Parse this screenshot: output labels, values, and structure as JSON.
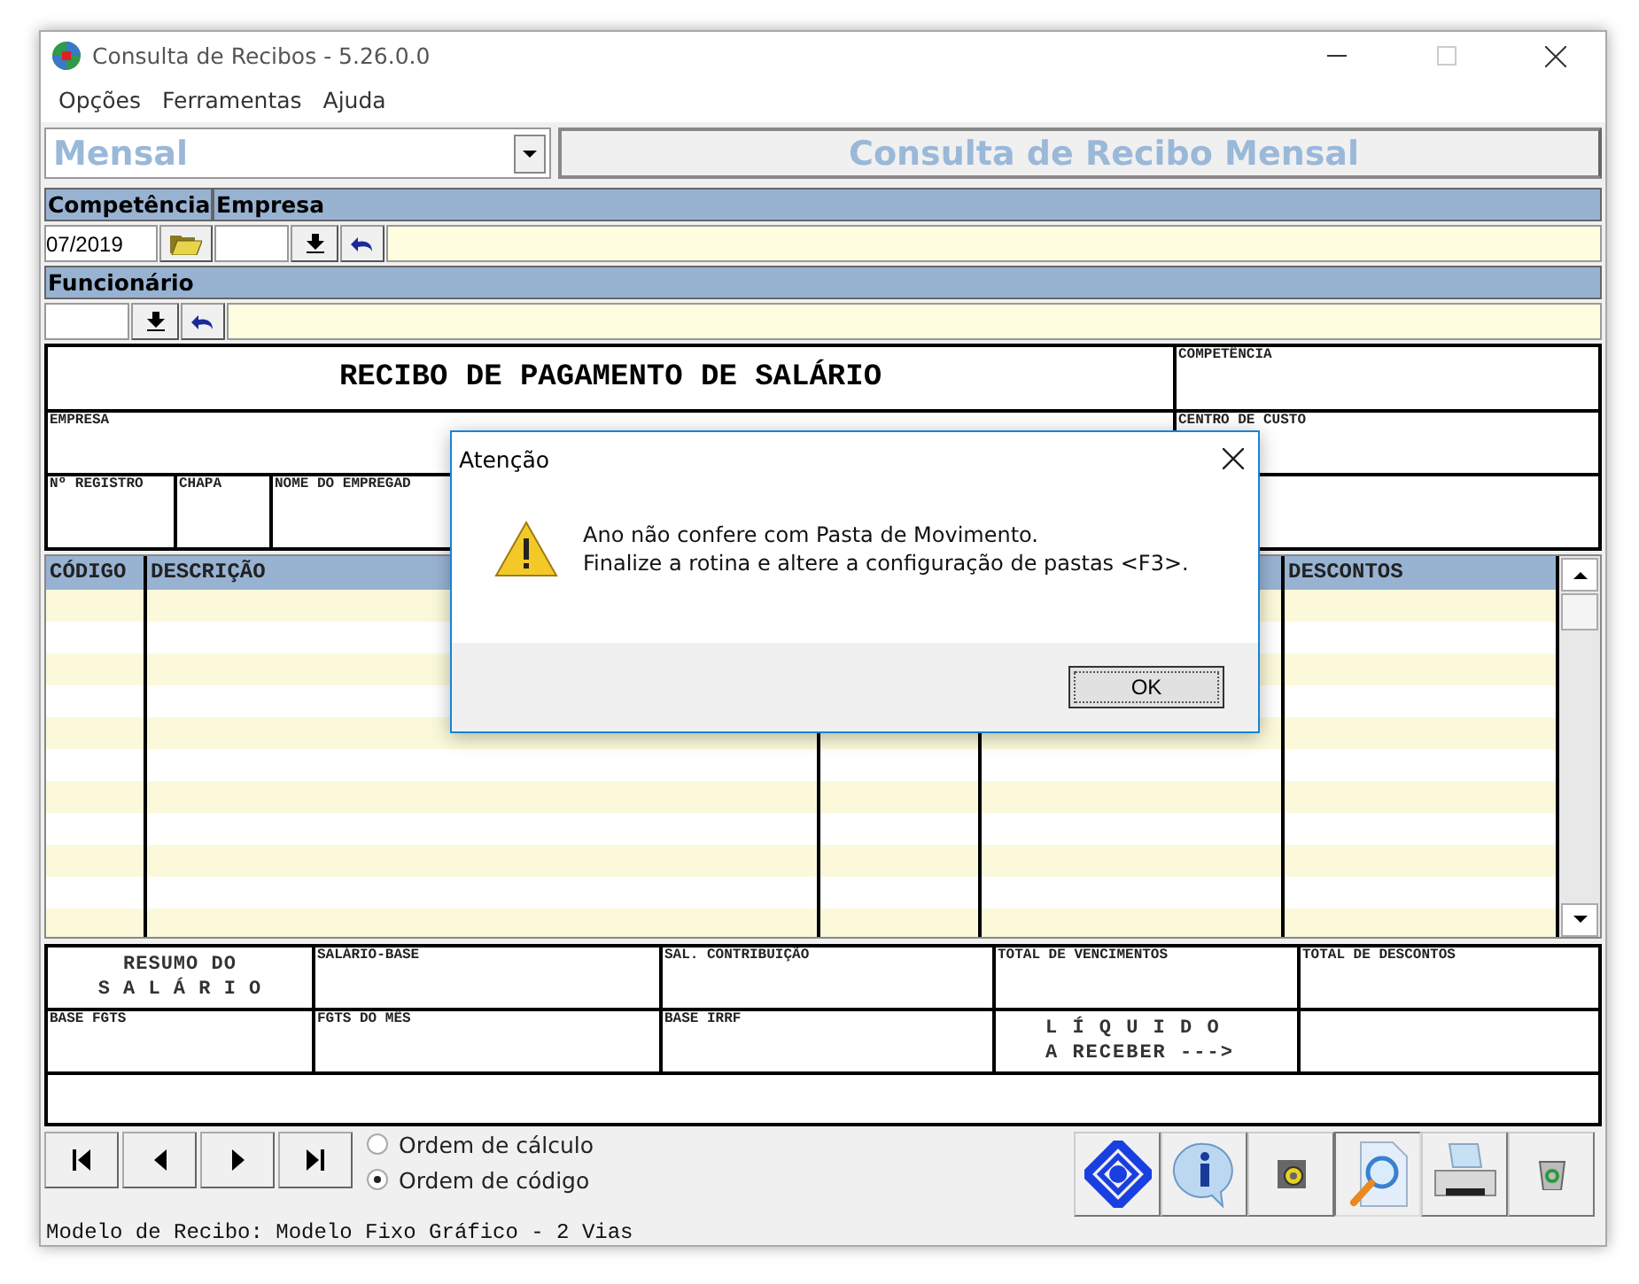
{
  "window": {
    "title": "Consulta de Recibos - 5.26.0.0"
  },
  "menu": [
    "Opções",
    "Ferramentas",
    "Ajuda"
  ],
  "mode_select": {
    "value": "Mensal"
  },
  "heading": "Consulta de Recibo Mensal",
  "filters": {
    "competencia": {
      "label": "Competência",
      "value": "07/2019"
    },
    "empresa": {
      "label": "Empresa"
    },
    "funcionario": {
      "label": "Funcionário"
    }
  },
  "receipt": {
    "title": "RECIBO DE PAGAMENTO DE SALÁRIO",
    "competencia": "COMPETÊNCIA",
    "empresa": "EMPRESA",
    "centro_de_custo": "CENTRO DE CUSTO",
    "registro": "Nº REGISTRO",
    "chapa": "CHAPA",
    "nome": "NOME DO EMPREGAD"
  },
  "grid": {
    "columns": [
      {
        "label": "CÓDIGO"
      },
      {
        "label": "DESCRIÇÃO"
      },
      {
        "label": "DESCONTOS"
      }
    ]
  },
  "summary": {
    "title": [
      "RESUMO DO",
      "S A L Á R I O"
    ],
    "cells": [
      "SALÁRIO-BASE",
      "SAL. CONTRIBUIÇÃO",
      "TOTAL DE VENCIMENTOS",
      "TOTAL DE DESCONTOS",
      "BASE FGTS",
      "FGTS DO MÊS",
      "BASE IRRF"
    ],
    "liquido": [
      "L Í Q U I D O",
      "A RECEBER --->"
    ]
  },
  "order": [
    {
      "label": "Ordem de cálculo",
      "selected": false
    },
    {
      "label": "Ordem de código",
      "selected": true
    }
  ],
  "status": "Modelo de Recibo: Modelo Fixo Gráfico - 2 Vias",
  "dialog": {
    "title": "Atenção",
    "message": [
      "Ano não confere com Pasta de Movimento.",
      "Finalize a rotina e altere a configuração de pastas <F3>."
    ],
    "button": "OK"
  }
}
